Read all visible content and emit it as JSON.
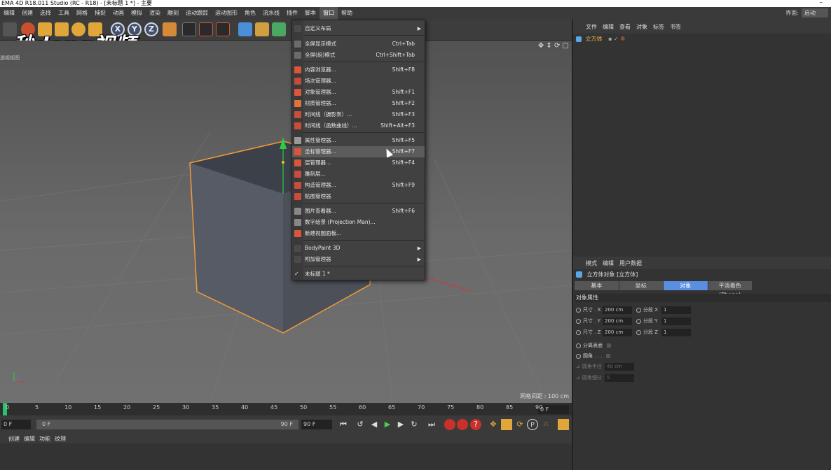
{
  "window": {
    "title": "EMA 4D R18.011 Studio (RC - R18) - [未标题 1 *] - 主要",
    "close": "–"
  },
  "menubar": {
    "items": [
      "编辑",
      "创建",
      "选择",
      "工具",
      "网格",
      "捕捉",
      "动画",
      "模拟",
      "渲染",
      "雕刻",
      "运动跟踪",
      "运动图形",
      "角色",
      "流水线",
      "插件",
      "脚本",
      "窗口",
      "帮助"
    ],
    "active": "窗口",
    "layout_label": "界面:",
    "layout_value": "启动"
  },
  "watermark": "秒dong视频",
  "viewport": {
    "label": "透视视图",
    "grid_info": "网格间距 : 100 cm",
    "nav_icons": "✥ ⇕ ⟳ ▢"
  },
  "window_menu": {
    "items": [
      {
        "label": "自定义布局",
        "key": "",
        "submenu": true,
        "color": "#4a4a4a"
      },
      {
        "label": "全屏显示模式",
        "key": "Ctrl+Tab",
        "color": "#6b6b6b"
      },
      {
        "label": "全屏(组)模式",
        "key": "Ctrl+Shift+Tab",
        "color": "#6b6b6b"
      },
      {
        "label": "内容浏览器...",
        "key": "Shift+F8",
        "color": "#d9563b"
      },
      {
        "label": "场次管理器...",
        "key": "",
        "color": "#c44a3a"
      },
      {
        "label": "对象管理器...",
        "key": "Shift+F1",
        "color": "#d9563b"
      },
      {
        "label": "材质管理器...",
        "key": "Shift+F2",
        "color": "#e0733c"
      },
      {
        "label": "时间线（摄影表）...",
        "key": "Shift+F3",
        "color": "#c84d3a"
      },
      {
        "label": "时间线（函数曲线）...",
        "key": "Shift+Alt+F3",
        "color": "#c84d3a"
      },
      {
        "label": "属性管理器...",
        "key": "Shift+F5",
        "color": "#999"
      },
      {
        "label": "坐标管理器...",
        "key": "Shift+F7",
        "color": "#d9563b"
      },
      {
        "label": "层管理器...",
        "key": "Shift+F4",
        "color": "#d9563b"
      },
      {
        "label": "雕刻层...",
        "key": "",
        "color": "#c84d3a"
      },
      {
        "label": "构造管理器...",
        "key": "Shift+F9",
        "color": "#c84d3a"
      },
      {
        "label": "贴图管理器",
        "key": "",
        "color": "#c84d3a"
      },
      {
        "label": "图片查看器...",
        "key": "Shift+F6",
        "color": "#888"
      },
      {
        "label": "数字绘景 (Projection Man)...",
        "key": "",
        "color": "#888"
      },
      {
        "label": "新建视图面板...",
        "key": "",
        "color": "#d9563b"
      },
      {
        "label": "BodyPaint 3D",
        "key": "",
        "submenu": true,
        "color": "#4a4a4a"
      },
      {
        "label": "附加管理器",
        "key": "",
        "submenu": true,
        "color": "#4a4a4a"
      },
      {
        "label": "未标题 1 *",
        "key": "",
        "checked": true,
        "color": "#4a4a4a"
      }
    ],
    "highlighted": "坐标管理器..."
  },
  "timeline": {
    "ticks": [
      "0",
      "5",
      "10",
      "15",
      "20",
      "25",
      "30",
      "35",
      "40",
      "45",
      "50",
      "55",
      "60",
      "65",
      "70",
      "75",
      "80",
      "85",
      "90"
    ],
    "end_field": "0 F"
  },
  "transport": {
    "start": "0 F",
    "range_start": "0 F",
    "range_end": "90 F",
    "end1": "90 F",
    "end2": "90 F"
  },
  "material_bar": [
    "创建",
    "编辑",
    "功能",
    "纹理"
  ],
  "object_manager": {
    "tabs": [
      "文件",
      "编辑",
      "查看",
      "对象",
      "标签",
      "书签"
    ],
    "object": "立方体"
  },
  "attributes": {
    "tabs": [
      "模式",
      "编辑",
      "用户数据"
    ],
    "title": "立方体对象 [立方体]",
    "segments": [
      "基本",
      "坐标",
      "对象",
      "平滑着色(Phong)"
    ],
    "active_segment": "对象",
    "section": "对象属性",
    "rows": [
      {
        "label": "尺寸 . X",
        "value": "200 cm",
        "label2": "分段 X",
        "value2": "1"
      },
      {
        "label": "尺寸 . Y",
        "value": "200 cm",
        "label2": "分段 Y",
        "value2": "1"
      },
      {
        "label": "尺寸 . Z",
        "value": "200 cm",
        "label2": "分段 Z",
        "value2": "1"
      }
    ],
    "separate_surfaces": "分离表面",
    "fillet": "圆角 . . .",
    "fillet_radius": "圆角半径",
    "fillet_radius_value": "40 cm",
    "fillet_subdiv": "圆角细分",
    "fillet_subdiv_value": "5"
  },
  "colors": {
    "accent": "#5b8ee0",
    "selection": "#f2b24a",
    "timeline_cursor": "#27c46b"
  }
}
